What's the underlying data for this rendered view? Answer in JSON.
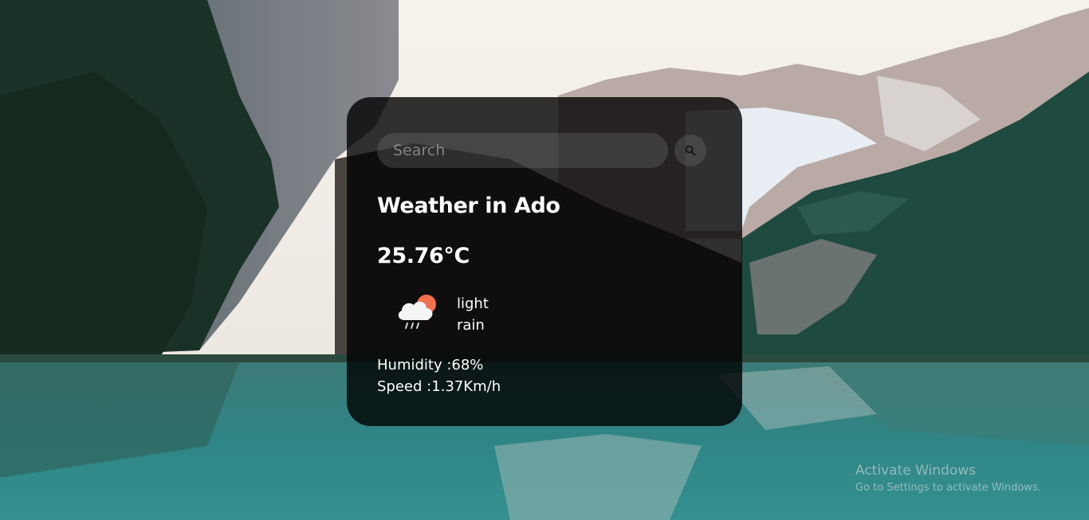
{
  "search": {
    "placeholder": "Search",
    "value": ""
  },
  "weather": {
    "city_heading": "Weather in Ado",
    "temperature": "25.76°C",
    "icon": "rain-cloud-sun-icon",
    "description": "light rain",
    "humidity": "Humidity :68%",
    "speed": "Speed :1.37Km/h"
  },
  "watermark": {
    "title": "Activate Windows",
    "subtitle": "Go to Settings to activate Windows."
  },
  "colors": {
    "card_background": "#000000",
    "text": "#ffffff",
    "sun": "#f07050",
    "lake": "#2f7f80",
    "sky": "#f3efe9"
  }
}
